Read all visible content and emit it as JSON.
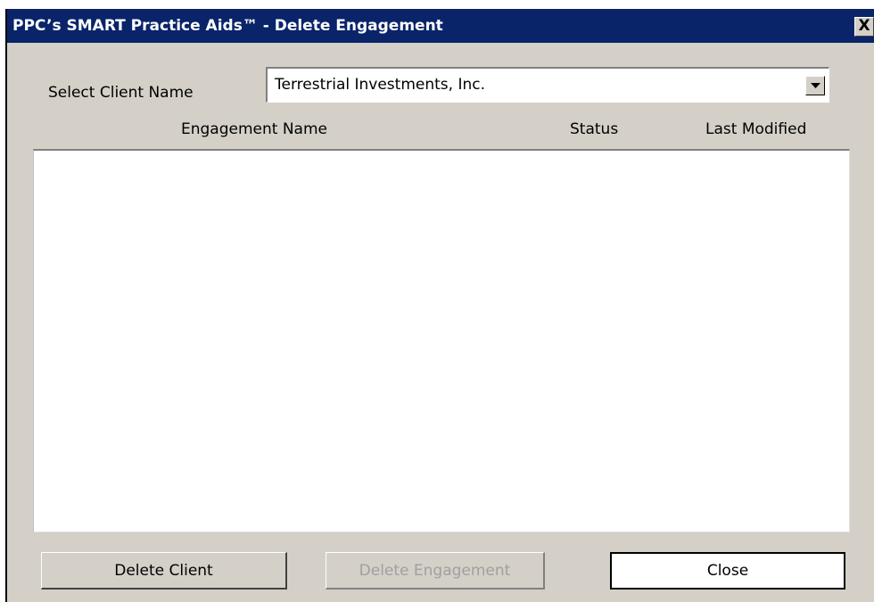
{
  "window": {
    "title": "PPC’s SMART Practice Aids™ - Delete Engagement",
    "close_glyph": "X"
  },
  "client_select": {
    "label": "Select Client Name",
    "selected_value": "Terrestrial Investments, Inc."
  },
  "engagement_list": {
    "columns": [
      "Engagement Name",
      "Status",
      "Last Modified"
    ],
    "rows": []
  },
  "buttons": {
    "delete_client": "Delete Client",
    "delete_engagement": "Delete Engagement",
    "close": "Close"
  },
  "icons": {
    "title_close": "close-icon",
    "dropdown": "chevron-down-icon"
  },
  "colors": {
    "titlebar": "#0a246a",
    "dialog_background": "#d4d0c8",
    "disabled_text": "#a0a0a0"
  }
}
